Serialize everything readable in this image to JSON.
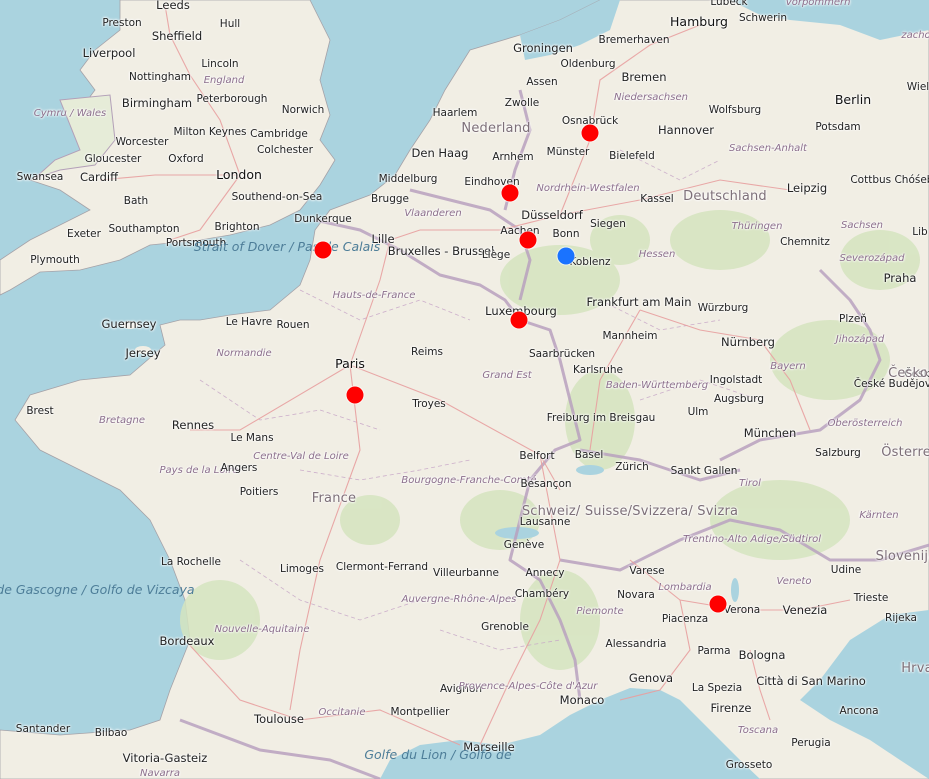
{
  "map": {
    "colors": {
      "sea": "#aad3df",
      "land": "#f1eee4",
      "forest": "#cfe0b6",
      "border": "#b3a0b8",
      "road": "#e8a8a8",
      "marker_red": "#ff0000",
      "marker_blue": "#1a73ff"
    },
    "countries": [
      "Nederland",
      "Deutschland",
      "France",
      "Schweiz/ Suisse/Svizzera/ Svizra",
      "Österrei",
      "Česko",
      "Slovenija",
      "Hrva"
    ],
    "cities": [
      "Leeds",
      "Hull",
      "Preston",
      "Sheffield",
      "Liverpool",
      "Lincoln",
      "Nottingham",
      "England",
      "Cymru / Wales",
      "Birmingham",
      "Peterborough",
      "Norwich",
      "Milton Keynes",
      "Worcester",
      "Cambridge",
      "Gloucester",
      "Oxford",
      "Colchester",
      "Swansea",
      "Cardiff",
      "London",
      "Southend-on-Sea",
      "Bath",
      "Exeter",
      "Southampton",
      "Portsmouth",
      "Brighton",
      "Plymouth",
      "Guernsey",
      "Jersey",
      "Groningen",
      "Bremerhaven",
      "Hamburg",
      "Lübeck",
      "Schwerin",
      "Oldenburg",
      "Bremen",
      "Assen",
      "Haarlem",
      "Zwolle",
      "Niedersachsen",
      "Osnabrück",
      "Wolfsburg",
      "Berlin",
      "Hannover",
      "Potsdam",
      "Den Haag",
      "Arnhem",
      "Münster",
      "Bielefeld",
      "Sachsen-Anhalt",
      "Middelburg",
      "Eindhoven",
      "Nordrhein-Westfalen",
      "Cottbus Chóśebuz",
      "Brugge",
      "Kassel",
      "Leipzig",
      "Dunkerque",
      "Vlaanderen",
      "Düsseldorf",
      "Lille",
      "Bruxelles - Brussel",
      "Aachen",
      "Siegen",
      "Bonn",
      "Thüringen",
      "Sachsen",
      "Chemnitz",
      "Strait of Dover / Pas de Calais",
      "Liège",
      "Koblenz",
      "Hessen",
      "Severozápad",
      "Praha",
      "Hauts-de-France",
      "Frankfurt am Main",
      "Luxembourg",
      "Würzburg",
      "Le Havre",
      "Rouen",
      "Plzeň",
      "Normandie",
      "Reims",
      "Mannheim",
      "Saarbrücken",
      "Nürnberg",
      "Jihozápad",
      "Paris",
      "Karlsruhe",
      "Bayern",
      "Ingolstadt",
      "České Budějovice",
      "Brest",
      "Grand Est",
      "Baden-Württemberg",
      "Augsburg",
      "Troyes",
      "Bretagne",
      "Rennes",
      "Freiburg im Breisgau",
      "Ulm",
      "Le Mans",
      "München",
      "Oberösterreich",
      "Pays de la Loire",
      "Angers",
      "Centre-Val de Loire",
      "Belfort",
      "Basel",
      "Zürich",
      "Sankt Gallen",
      "Salzburg",
      "Bourgogne-Franche-Comté",
      "Besançon",
      "Tirol",
      "Poitiers",
      "Lausanne",
      "Kärnten",
      "Genève",
      "Trentino-Alto Adige/Südtirol",
      "La Rochelle",
      "Limoges",
      "Clermont-Ferrand",
      "Villeurbanne",
      "Annecy",
      "Varese",
      "Udine",
      "Golfe de Gascogne / Golfo de Vizcaya",
      "Veneto",
      "Lombardia",
      "Chambéry",
      "Novara",
      "Trieste",
      "Nouvelle-Aquitaine",
      "Auvergne-Rhône-Alpes",
      "Piemonte",
      "Verona",
      "Venezia",
      "Rijeka",
      "Grenoble",
      "Piacenza",
      "Bordeaux",
      "Alessandria",
      "Parma",
      "Bologna",
      "Città di San Marino",
      "Genova",
      "Avignon",
      "Provence-Alpes-Côte d'Azur",
      "Toulouse",
      "Occitanie",
      "Montpellier",
      "Monaco",
      "La Spezia",
      "Ancona",
      "Santander",
      "Bilbao",
      "Marseille",
      "Golfe du Lion / Golfo de",
      "Firenze",
      "Toscana",
      "Perugia",
      "Vitoria-Gasteiz",
      "Navarra",
      "Grosseto",
      "Lib",
      "Wiel",
      "zacho",
      "Vorpommern",
      "Česk"
    ],
    "markers": [
      {
        "name": "Osnabrück",
        "color": "#ff0000"
      },
      {
        "name": "Eindhoven",
        "color": "#ff0000"
      },
      {
        "name": "Aachen",
        "color": "#ff0000"
      },
      {
        "name": "Bonn",
        "color": "#1a73ff"
      },
      {
        "name": "Dunkerque",
        "color": "#ff0000"
      },
      {
        "name": "Luxembourg",
        "color": "#ff0000"
      },
      {
        "name": "Paris",
        "color": "#ff0000"
      },
      {
        "name": "Verona",
        "color": "#ff0000"
      }
    ]
  }
}
